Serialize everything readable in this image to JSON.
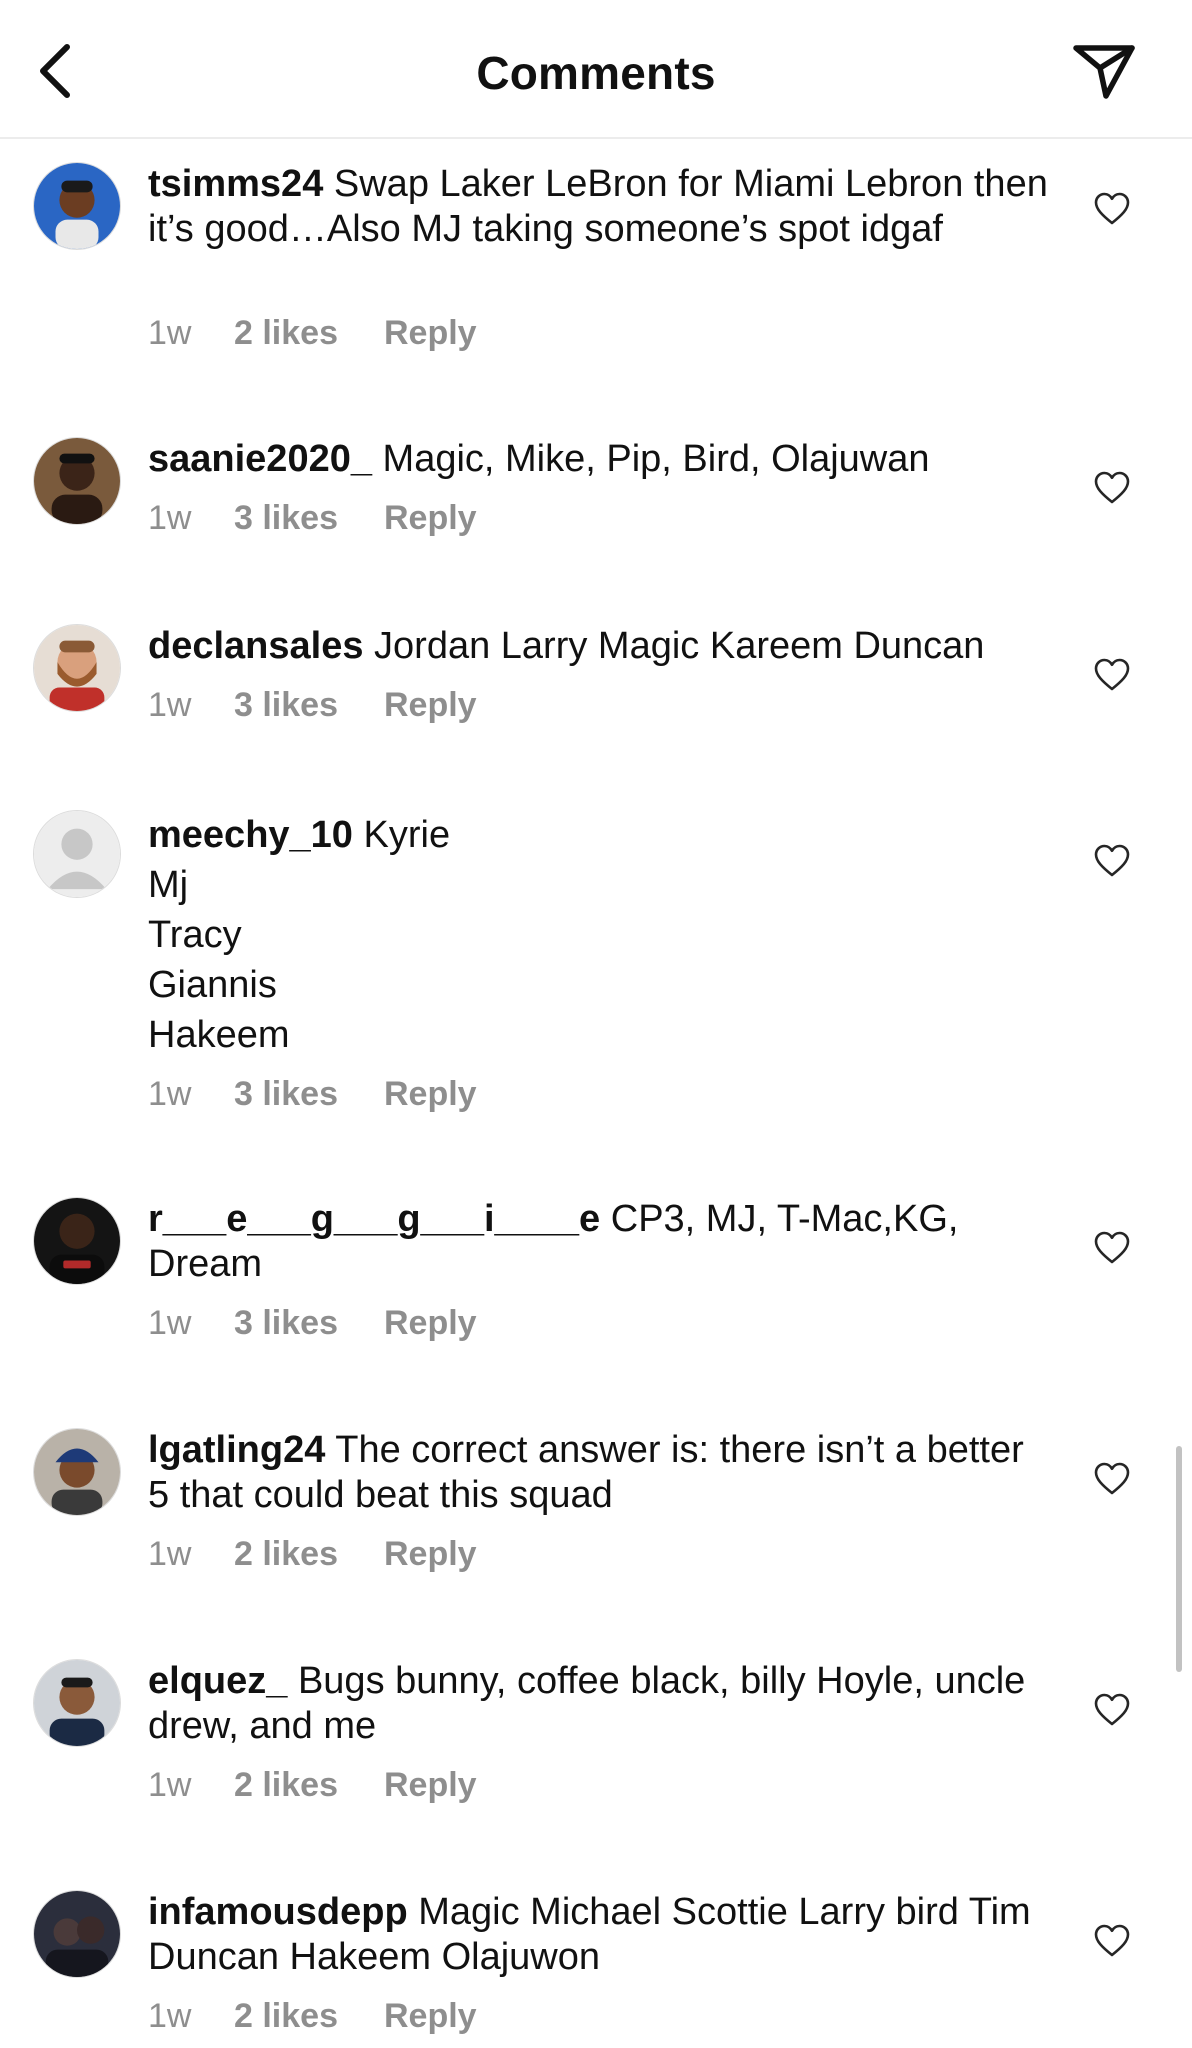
{
  "header": {
    "title": "Comments"
  },
  "comments": [
    {
      "username": "tsimms24",
      "text": "Swap Laker LeBron for Miami Lebron then it’s good…Also MJ taking someone’s spot idgaf",
      "time": "1w",
      "likes": "2 likes",
      "reply": "Reply",
      "avatar": "photo-boy-blue-background"
    },
    {
      "username": "saanie2020_",
      "text": "Magic, Mike, Pip, Bird, Olajuwan",
      "time": "1w",
      "likes": "3 likes",
      "reply": "Reply",
      "avatar": "photo-man-brown-background"
    },
    {
      "username": "declansales",
      "text": "Jordan Larry Magic Kareem Duncan",
      "time": "1w",
      "likes": "3 likes",
      "reply": "Reply",
      "avatar": "photo-man-red-shirt"
    },
    {
      "username": "meechy_10",
      "text": "Kyrie\nMj\nTracy\nGiannis\nHakeem",
      "time": "1w",
      "likes": "3 likes",
      "reply": "Reply",
      "avatar": "default-avatar"
    },
    {
      "username": "r___e___g___g___i____e",
      "text": "CP3, MJ, T-Mac,KG, Dream",
      "time": "1w",
      "likes": "3 likes",
      "reply": "Reply",
      "avatar": "photo-man-black-shirt"
    },
    {
      "username": "lgatling24",
      "text": "The correct answer is: there isn’t a better 5 that could beat this squad",
      "time": "1w",
      "likes": "2 likes",
      "reply": "Reply",
      "avatar": "photo-kid-dodgers-cap"
    },
    {
      "username": "elquez_",
      "text": "Bugs bunny, coffee black, billy Hoyle, uncle drew, and me",
      "time": "1w",
      "likes": "2 likes",
      "reply": "Reply",
      "avatar": "photo-man-hoodie"
    },
    {
      "username": "infamousdepp",
      "text": "Magic Michael Scottie Larry bird Tim Duncan Hakeem Olajuwon",
      "time": "1w",
      "likes": "2 likes",
      "reply": "Reply",
      "avatar": "photo-dark-group"
    }
  ],
  "icons": {
    "back": "chevron-left-icon",
    "share": "paper-plane-icon",
    "like": "heart-outline-icon"
  },
  "colors": {
    "text": "#111111",
    "meta": "#8e8e8e",
    "divider": "#ececec",
    "scrollbar": "#c2c2c2"
  }
}
